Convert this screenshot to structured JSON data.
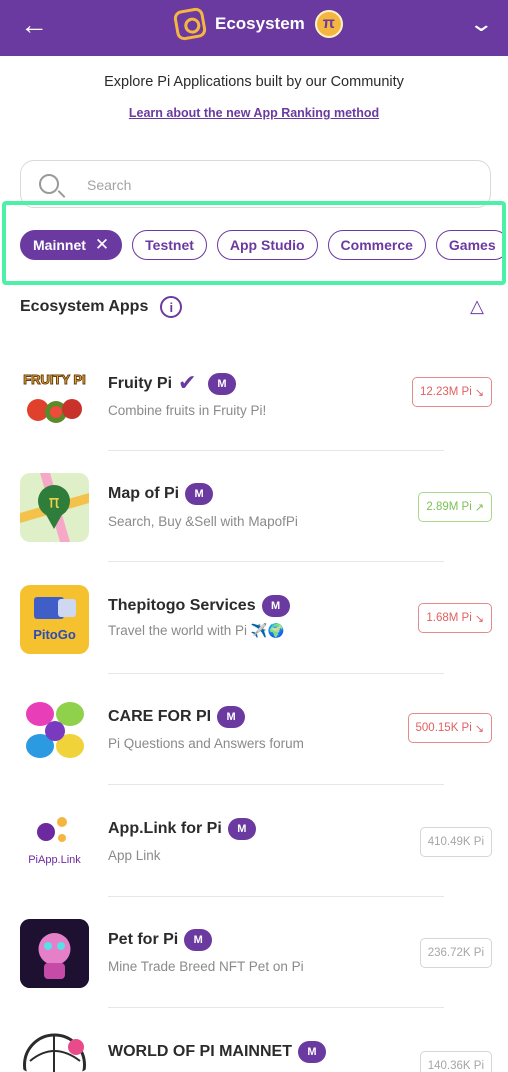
{
  "header": {
    "title": "Ecosystem",
    "back_icon": "arrow-left-icon",
    "logo": "ecosystem-logo-icon",
    "coin_symbol": "π",
    "menu_icon": "chevron-down-icon"
  },
  "intro": {
    "subtitle": "Explore Pi Applications built by our Community",
    "link": "Learn about the new App Ranking method"
  },
  "search": {
    "placeholder": "Search",
    "value": ""
  },
  "filters": [
    {
      "label": "Mainnet",
      "active": true
    },
    {
      "label": "Testnet",
      "active": false
    },
    {
      "label": "App Studio",
      "active": false
    },
    {
      "label": "Commerce",
      "active": false
    },
    {
      "label": "Games",
      "active": false
    }
  ],
  "section": {
    "title": "Ecosystem Apps",
    "info": "i"
  },
  "badge": "M",
  "colors": {
    "brand": "#6b3aa0",
    "highlight": "#4ef0a8",
    "down": "#e26060",
    "up": "#7cc154"
  },
  "apps": [
    {
      "name": "Fruity Pi",
      "verified": true,
      "desc": "Combine fruits in Fruity Pi!",
      "value": "12.23M Pi",
      "trend": "down"
    },
    {
      "name": "Map of Pi",
      "verified": false,
      "desc": "Search, Buy &Sell with MapofPi",
      "value": "2.89M Pi",
      "trend": "up"
    },
    {
      "name": "Thepitogo Services",
      "verified": false,
      "desc": "Travel the world with Pi ✈️🌍",
      "value": "1.68M Pi",
      "trend": "down"
    },
    {
      "name": "CARE FOR PI",
      "verified": false,
      "desc": "Pi Questions and Answers forum",
      "value": "500.15K Pi",
      "trend": "down"
    },
    {
      "name": "App.Link for Pi",
      "verified": false,
      "desc": "App Link",
      "value": "410.49K Pi",
      "trend": "flat"
    },
    {
      "name": "Pet for Pi",
      "verified": false,
      "desc": "Mine Trade Breed NFT Pet on Pi",
      "value": "236.72K Pi",
      "trend": "flat"
    },
    {
      "name": "WORLD OF PI MAINNET",
      "verified": false,
      "desc": "",
      "value": "140.36K Pi",
      "trend": "flat"
    }
  ],
  "icon_labels": {
    "fruity": "FRUITY PI",
    "pitogo": "PitoGo",
    "applink": "PiApp.Link"
  }
}
